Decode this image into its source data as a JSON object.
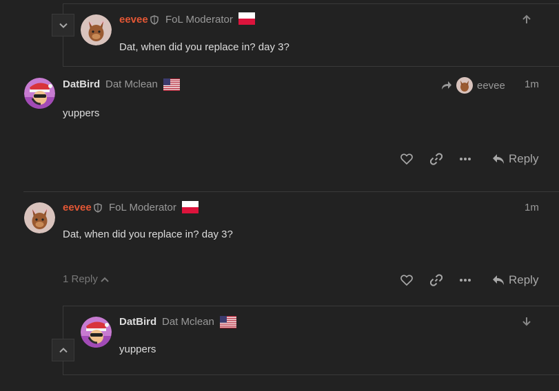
{
  "colors": {
    "bg": "#222222",
    "accent_red": "#e45735",
    "muted": "#999999",
    "text": "#dddddd"
  },
  "posts": [
    {
      "username": "eevee",
      "role": "FoL Moderator",
      "flag": "poland",
      "text": "Dat, when did you replace in? day 3?",
      "nav_icon": "arrow-up-icon"
    },
    {
      "username": "DatBird",
      "fullname": "Dat Mclean",
      "flag": "usa",
      "text": "yuppers",
      "reply_to_user": "eevee",
      "time": "1m",
      "reply_label": "Reply"
    },
    {
      "username": "eevee",
      "role": "FoL Moderator",
      "flag": "poland",
      "text": "Dat, when did you replace in? day 3?",
      "time": "1m",
      "replies_label": "1 Reply",
      "reply_label": "Reply"
    },
    {
      "username": "DatBird",
      "fullname": "Dat Mclean",
      "flag": "usa",
      "text": "yuppers",
      "nav_icon": "arrow-down-icon"
    }
  ]
}
